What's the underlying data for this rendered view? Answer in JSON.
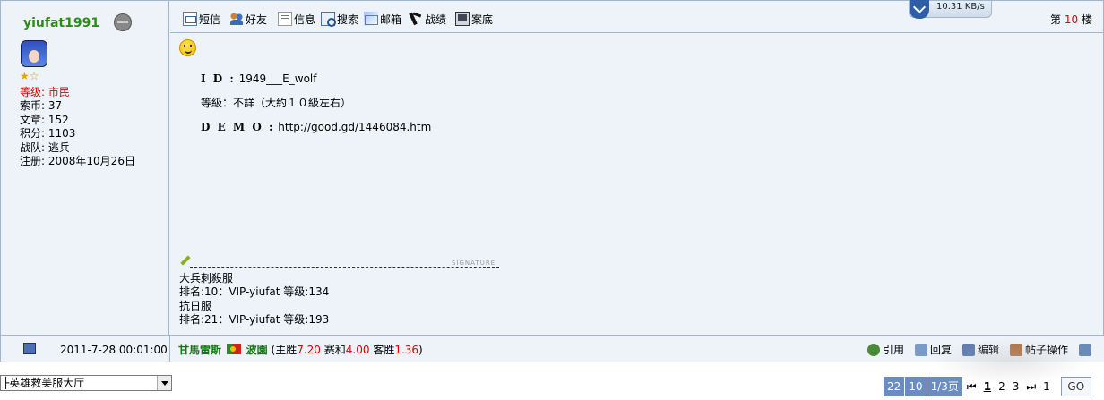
{
  "user": {
    "name": "yiufat1991",
    "stats": [
      {
        "label": "等级:",
        "value": "市民",
        "highlight": true
      },
      {
        "label": "索币:",
        "value": "37"
      },
      {
        "label": "文章:",
        "value": "152"
      },
      {
        "label": "积分:",
        "value": "1103"
      },
      {
        "label": "战队:",
        "value": "逃兵"
      },
      {
        "label": "注册:",
        "value": "2008年10月26日"
      }
    ]
  },
  "toolbar": {
    "items": [
      "短信",
      "好友",
      "信息",
      "搜索",
      "邮箱",
      "战绩",
      "案底"
    ],
    "net_speed": "10.31 KB/s",
    "floor_prefix": "第",
    "floor_number": "10",
    "floor_suffix": "楼"
  },
  "post": {
    "id_label": "I D :",
    "id_value": "1949___E_wolf",
    "level_line": "等級：不詳（大約１０級左右）",
    "demo_label": "D E M O :",
    "demo_value": "http://good.gd/1446084.htm"
  },
  "signature": {
    "label": "SIGNATURE",
    "lines": [
      "大兵刺殺服",
      "排名:10：VIP-yiufat 等级:134",
      "抗日服",
      "排名:21：VIP-yiufat 等级:193"
    ]
  },
  "footer": {
    "time": "2011-7-28 00:01:00",
    "team1": "甘馬雷斯",
    "team2": "波園",
    "odds_open": "(主胜",
    "home_odds": "7.20",
    "draw_label": "赛和",
    "draw_odds": "4.00",
    "away_label": "客胜",
    "away_odds": "1.36",
    "odds_close": ")",
    "actions": [
      "引用",
      "回复",
      "编辑",
      "帖子操作"
    ]
  },
  "bottom": {
    "forum_select": "├英雄救美服大厅",
    "pager_total": "22",
    "pager_per": "10",
    "pager_pages": "1/3页",
    "first_icon": "⏮",
    "pages": [
      "1",
      "2",
      "3"
    ],
    "last_icon": "⏭",
    "jump_value": "1",
    "go_label": "GO"
  }
}
